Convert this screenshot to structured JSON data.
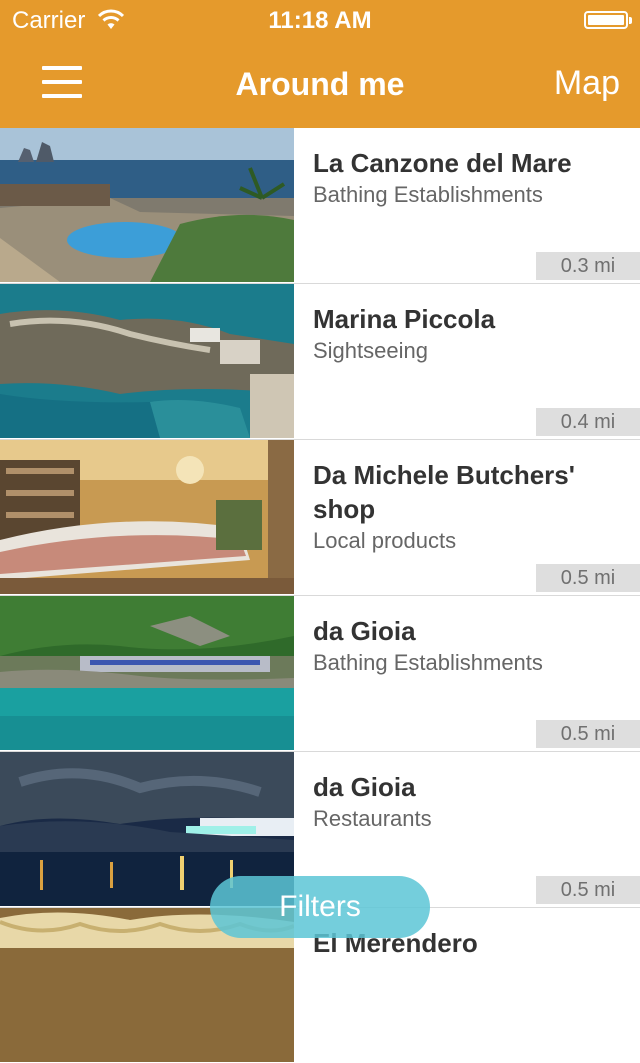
{
  "status_bar": {
    "carrier": "Carrier",
    "time": "11:18 AM",
    "battery_level": 1.0
  },
  "nav": {
    "title": "Around me",
    "right_button": "Map",
    "left_icon": "hamburger-menu-icon"
  },
  "places": [
    {
      "name": "La Canzone del Mare",
      "category": "Bathing Establishments",
      "distance": "0.3 mi"
    },
    {
      "name": "Marina Piccola",
      "category": "Sightseeing",
      "distance": "0.4 mi"
    },
    {
      "name": "Da Michele Butchers' shop",
      "category": "Local products",
      "distance": "0.5 mi"
    },
    {
      "name": "da Gioia",
      "category": "Bathing Establishments",
      "distance": "0.5 mi"
    },
    {
      "name": "da Gioia",
      "category": "Restaurants",
      "distance": "0.5 mi"
    },
    {
      "name": "El Merendero",
      "category": "",
      "distance": ""
    }
  ],
  "filters_button": "Filters",
  "colors": {
    "accent": "#e59a2c",
    "filters": "#5cc6d6",
    "distance_badge": "#dedede"
  }
}
